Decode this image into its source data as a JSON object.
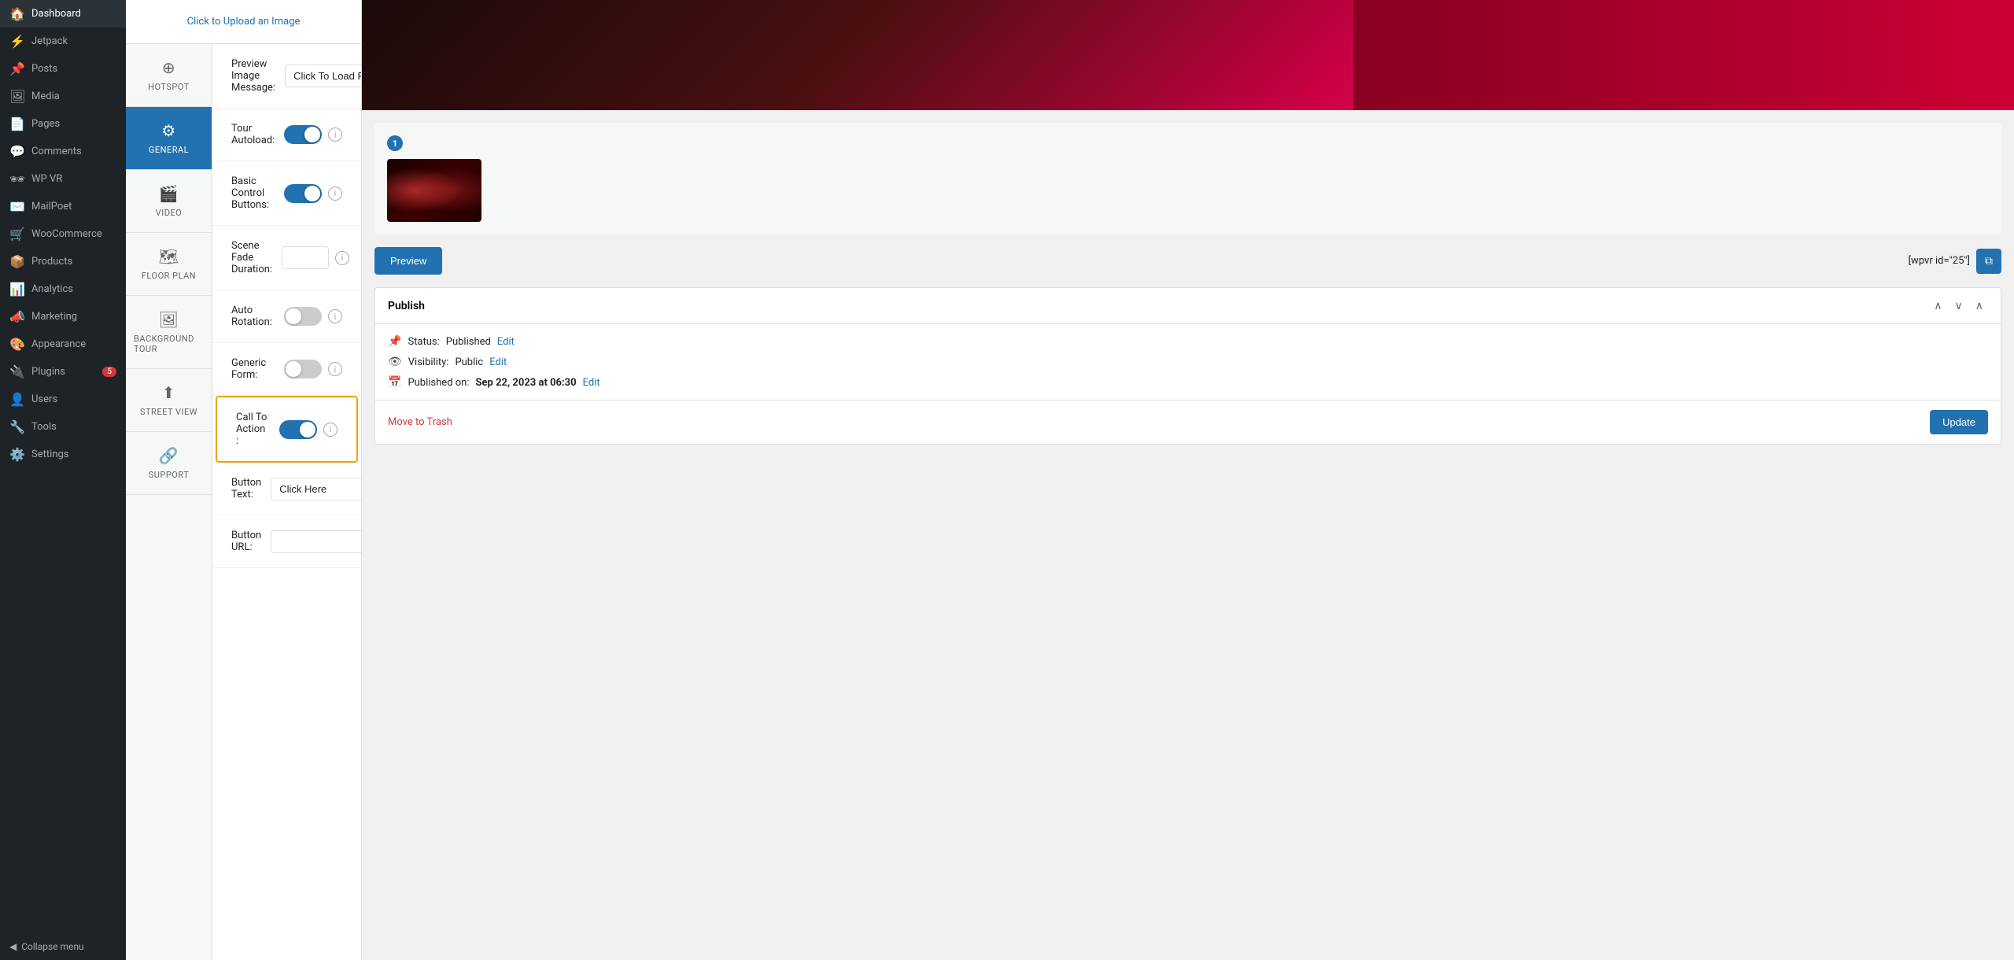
{
  "sidebar": {
    "items": [
      {
        "id": "dashboard",
        "label": "Dashboard",
        "icon": "🏠",
        "active": false
      },
      {
        "id": "jetpack",
        "label": "Jetpack",
        "icon": "⚡",
        "active": false
      },
      {
        "id": "posts",
        "label": "Posts",
        "icon": "📌",
        "active": false
      },
      {
        "id": "media",
        "label": "Media",
        "icon": "🖼",
        "active": false
      },
      {
        "id": "pages",
        "label": "Pages",
        "icon": "📄",
        "active": false
      },
      {
        "id": "comments",
        "label": "Comments",
        "icon": "💬",
        "active": false
      },
      {
        "id": "wpvr",
        "label": "WP VR",
        "icon": "🕶",
        "active": false
      },
      {
        "id": "mailpoet",
        "label": "MailPoet",
        "icon": "✉️",
        "active": false
      },
      {
        "id": "woocommerce",
        "label": "WooCommerce",
        "icon": "🛒",
        "active": false
      },
      {
        "id": "products",
        "label": "Products",
        "icon": "📦",
        "active": false
      },
      {
        "id": "analytics",
        "label": "Analytics",
        "icon": "📊",
        "active": false
      },
      {
        "id": "marketing",
        "label": "Marketing",
        "icon": "📣",
        "active": false
      },
      {
        "id": "appearance",
        "label": "Appearance",
        "icon": "🎨",
        "active": false
      },
      {
        "id": "plugins",
        "label": "Plugins",
        "icon": "🔌",
        "active": false,
        "badge": "5"
      },
      {
        "id": "users",
        "label": "Users",
        "icon": "👤",
        "active": false
      },
      {
        "id": "tools",
        "label": "Tools",
        "icon": "🔧",
        "active": false
      },
      {
        "id": "settings",
        "label": "Settings",
        "icon": "⚙️",
        "active": false
      }
    ],
    "collapse_label": "Collapse menu"
  },
  "tabs": [
    {
      "id": "hotspot",
      "label": "HOTSPOT",
      "icon": "⊕",
      "active": false
    },
    {
      "id": "general",
      "label": "GENERAL",
      "icon": "⚙",
      "active": true
    },
    {
      "id": "video",
      "label": "VIDEO",
      "icon": "🎬",
      "active": false
    },
    {
      "id": "floorplan",
      "label": "FLOOR PLAN",
      "icon": "🗺",
      "active": false
    },
    {
      "id": "background_tour",
      "label": "BACKGROUND TOUR",
      "icon": "🖼",
      "active": false
    },
    {
      "id": "street_view",
      "label": "STREET VIEW",
      "icon": "⬆",
      "active": false
    },
    {
      "id": "support",
      "label": "SUPPORT",
      "icon": "🔗",
      "active": false
    }
  ],
  "upload": {
    "label": "Click to Upload an Image"
  },
  "settings": [
    {
      "id": "preview_image_message",
      "label": "Preview Image Message:",
      "type": "text",
      "value": "Click To Load Panorama"
    },
    {
      "id": "tour_autoload",
      "label": "Tour Autoload:",
      "type": "toggle",
      "value": true
    },
    {
      "id": "basic_control_buttons",
      "label": "Basic Control Buttons:",
      "type": "toggle",
      "value": true
    },
    {
      "id": "scene_fade_duration",
      "label": "Scene Fade Duration:",
      "type": "small_input",
      "value": ""
    },
    {
      "id": "auto_rotation",
      "label": "Auto Rotation:",
      "type": "toggle",
      "value": false
    },
    {
      "id": "generic_form",
      "label": "Generic Form:",
      "type": "toggle",
      "value": false
    },
    {
      "id": "call_to_action",
      "label": "Call To Action :",
      "type": "toggle",
      "value": true,
      "highlighted": true
    },
    {
      "id": "button_text",
      "label": "Button Text:",
      "type": "text",
      "value": "Click Here"
    },
    {
      "id": "button_url",
      "label": "Button URL:",
      "type": "text",
      "value": ""
    }
  ],
  "preview": {
    "thumbnail_count": "1",
    "preview_btn_label": "Preview",
    "shortcode": "[wpvr id=\"25\"]",
    "copy_icon": "⧉"
  },
  "publish": {
    "title": "Publish",
    "status_label": "Status:",
    "status_value": "Published",
    "status_link": "Edit",
    "visibility_label": "Visibility:",
    "visibility_value": "Public",
    "visibility_link": "Edit",
    "published_label": "Published on:",
    "published_date": "Sep 22, 2023 at 06:30",
    "published_link": "Edit",
    "move_to_trash": "Move to Trash",
    "update_label": "Update",
    "chevron_up": "∧",
    "chevron_down": "∨",
    "chevron_collapse": "∧"
  }
}
